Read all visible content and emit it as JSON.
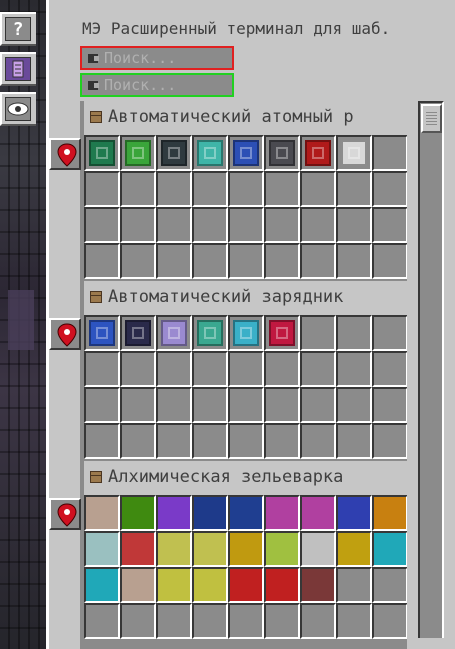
{
  "title": "МЭ Расширенный терминал для шаб.",
  "search_primary": {
    "placeholder": "Поиск...",
    "border_color": "#e02020"
  },
  "search_secondary": {
    "placeholder": "Поиск...",
    "border_color": "#20d020"
  },
  "left_tabs": [
    {
      "icon": "help-icon",
      "glyph": "?"
    },
    {
      "icon": "pattern-icon",
      "glyph": ""
    },
    {
      "icon": "eye-icon",
      "glyph": ""
    }
  ],
  "groups": [
    {
      "name": "Автоматический атомный р",
      "rows": 4,
      "items": [
        "#1f7a4e",
        "#3aa53a",
        "#2f3a3f",
        "#3fb5a8",
        "#2c4fb5",
        "#4a4a50",
        "#b01a1a",
        "#d8d8d8"
      ]
    },
    {
      "name": "Автоматический зарядник",
      "rows": 4,
      "items": [
        "#2d54c0",
        "#2a2a4a",
        "#9a8ad0",
        "#3aa890",
        "#3ab0c8",
        "#c01840"
      ]
    },
    {
      "name": "Алхимическая зельеварка",
      "rows": 4,
      "items": [
        "#b8a090",
        "#3f8a10",
        "#7a3ac8",
        "#1e3a8a",
        "#1f3e90",
        "#b040a0",
        "#b040a0",
        "#2f3fb0",
        "#c88010",
        "#9ac0c0",
        "#c03838",
        "#c0c050",
        "#c0c050",
        "#c09a10",
        "#a0c040",
        "#c0c0c0",
        "#c0a010",
        "#20a8b8",
        "#20a8b8",
        "#b8a090",
        "#c0c040",
        "#c0c040",
        "#c02020",
        "#c02020",
        "#7a3838"
      ]
    }
  ],
  "colors": {
    "panel": "#c6c6c6",
    "slot": "#8b8b8b",
    "text": "#3f3f3f",
    "pin": "#d01020"
  }
}
